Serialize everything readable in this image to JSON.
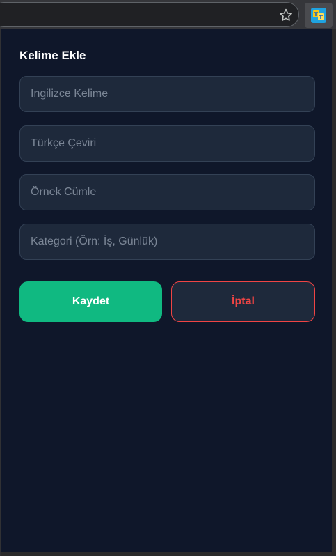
{
  "browser": {
    "star_icon": "star-outline-icon",
    "extension_icon": "dictionary-extension-icon"
  },
  "popup": {
    "title": "Kelime Ekle",
    "fields": {
      "english_placeholder": "İngilizce Kelime",
      "turkish_placeholder": "Türkçe Çeviri",
      "example_placeholder": "Örnek Cümle",
      "category_placeholder": "Kategori (Örn: İş, Günlük)"
    },
    "buttons": {
      "save_label": "Kaydet",
      "cancel_label": "İptal"
    }
  },
  "colors": {
    "popup_bg": "#0f172a",
    "field_bg": "#1e293b",
    "save": "#10b981",
    "cancel": "#ef4444"
  }
}
